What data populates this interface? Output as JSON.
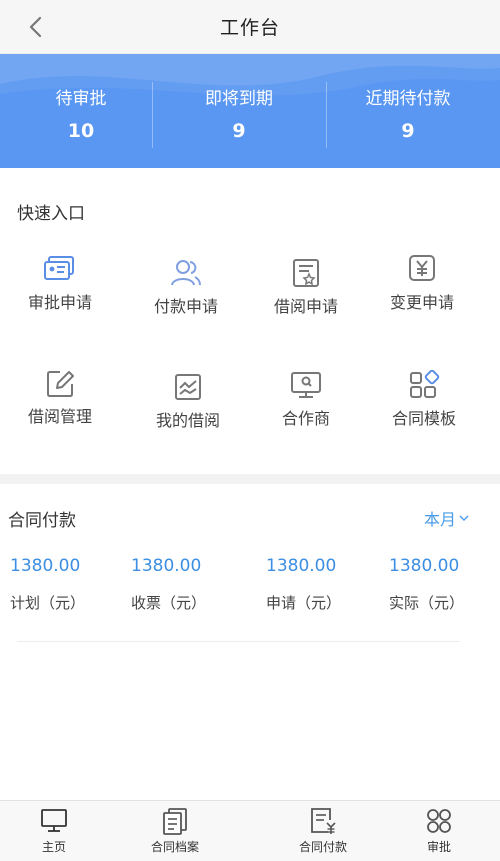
{
  "header": {
    "title": "工作台"
  },
  "stats": [
    {
      "label": "待审批",
      "value": "10"
    },
    {
      "label": "即将到期",
      "value": "9"
    },
    {
      "label": "近期待付款",
      "value": "9"
    }
  ],
  "quick_entry": {
    "title": "快速入口",
    "items": [
      {
        "label": "审批申请",
        "icon": "id-card-icon"
      },
      {
        "label": "付款申请",
        "icon": "users-icon"
      },
      {
        "label": "借阅申请",
        "icon": "document-star-icon"
      },
      {
        "label": "变更申请",
        "icon": "yen-box-icon"
      },
      {
        "label": "借阅管理",
        "icon": "edit-icon"
      },
      {
        "label": "我的借阅",
        "icon": "chart-icon"
      },
      {
        "label": "合作商",
        "icon": "monitor-icon"
      },
      {
        "label": "合同模板",
        "icon": "apps-icon"
      }
    ]
  },
  "contract_payment": {
    "title": "合同付款",
    "period": "本月",
    "items": [
      {
        "value": "1380.00",
        "label": "计划（元）"
      },
      {
        "value": "1380.00",
        "label": "收票（元）"
      },
      {
        "value": "1380.00",
        "label": "申请（元）"
      },
      {
        "value": "1380.00",
        "label": "实际（元）"
      }
    ]
  },
  "tabbar": [
    {
      "label": "主页",
      "icon": "monitor-icon"
    },
    {
      "label": "合同档案",
      "icon": "files-icon"
    },
    {
      "label": "合同付款",
      "icon": "invoice-yen-icon"
    },
    {
      "label": "审批",
      "icon": "four-circles-icon"
    }
  ],
  "colors": {
    "accent": "#5a97f2",
    "link": "#3c8ee3",
    "icon": "#8a99b3"
  }
}
